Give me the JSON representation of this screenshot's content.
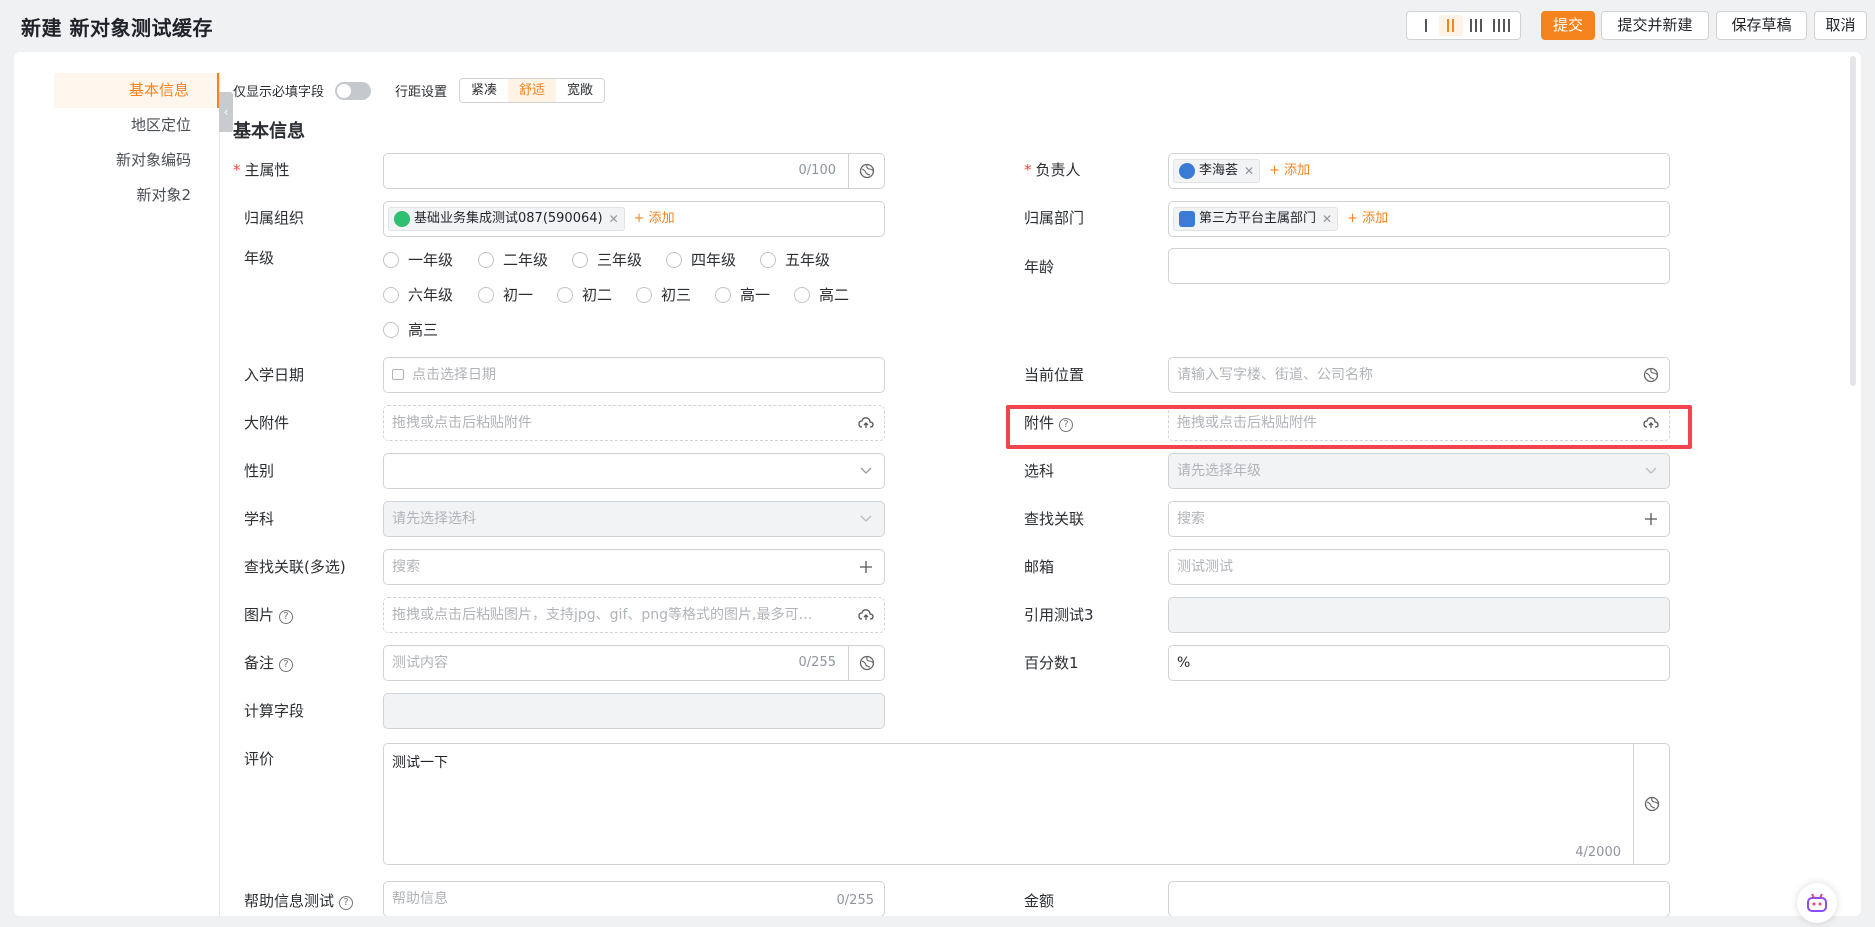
{
  "header": {
    "title": "新建 新对象测试缓存",
    "buttons": {
      "submit": "提交",
      "submit_new": "提交并新建",
      "save_draft": "保存草稿",
      "cancel": "取消"
    }
  },
  "sidebar": {
    "items": [
      {
        "label": "基本信息",
        "active": true
      },
      {
        "label": "地区定位",
        "active": false
      },
      {
        "label": "新对象编码",
        "active": false
      },
      {
        "label": "新对象2",
        "active": false
      }
    ]
  },
  "toolbar": {
    "required_only_label": "仅显示必填字段",
    "row_spacing_label": "行距设置",
    "row_spacing_options": [
      "紧凑",
      "舒适",
      "宽敞"
    ],
    "row_spacing_selected": "舒适"
  },
  "section": {
    "title": "基本信息"
  },
  "form": {
    "owner_attr": {
      "label": "主属性",
      "counter": "0/100"
    },
    "owner": {
      "label": "负责人",
      "tag": "李海荟",
      "add": "+ 添加"
    },
    "org": {
      "label": "归属组织",
      "tag": "基础业务集成测试087(590064)",
      "add": "+ 添加"
    },
    "dept": {
      "label": "归属部门",
      "tag": "第三方平台主属部门",
      "add": "+ 添加"
    },
    "grade": {
      "label": "年级",
      "options": [
        "一年级",
        "二年级",
        "三年级",
        "四年级",
        "五年级",
        "六年级",
        "初一",
        "初二",
        "初三",
        "高一",
        "高二",
        "高三"
      ]
    },
    "age": {
      "label": "年龄"
    },
    "enroll_date": {
      "label": "入学日期",
      "placeholder": "点击选择日期"
    },
    "location": {
      "label": "当前位置",
      "placeholder": "请输入写字楼、街道、公司名称"
    },
    "big_attachment": {
      "label": "大附件",
      "placeholder": "拖拽或点击后粘贴附件"
    },
    "attachment": {
      "label": "附件",
      "placeholder": "拖拽或点击后粘贴附件"
    },
    "gender": {
      "label": "性别"
    },
    "elective": {
      "label": "选科",
      "placeholder": "请先选择年级"
    },
    "subject": {
      "label": "学科",
      "placeholder": "请先选择选科"
    },
    "lookup": {
      "label": "查找关联",
      "placeholder": "搜索"
    },
    "lookup_multi": {
      "label": "查找关联(多选)",
      "placeholder": "搜索"
    },
    "email": {
      "label": "邮箱",
      "placeholder": "测试测试"
    },
    "image": {
      "label": "图片",
      "placeholder": "拖拽或点击后粘贴图片，支持jpg、gif、png等格式的图片,最多可…"
    },
    "ref_test3": {
      "label": "引用测试3"
    },
    "remark": {
      "label": "备注",
      "placeholder": "测试内容",
      "counter": "0/255"
    },
    "percent1": {
      "label": "百分数1",
      "value": "%"
    },
    "calc": {
      "label": "计算字段"
    },
    "review": {
      "label": "评价",
      "value": "测试一下",
      "counter": "4/2000"
    },
    "help_test": {
      "label": "帮助信息测试",
      "placeholder": "帮助信息",
      "counter": "0/255"
    },
    "amount": {
      "label": "金额"
    }
  }
}
